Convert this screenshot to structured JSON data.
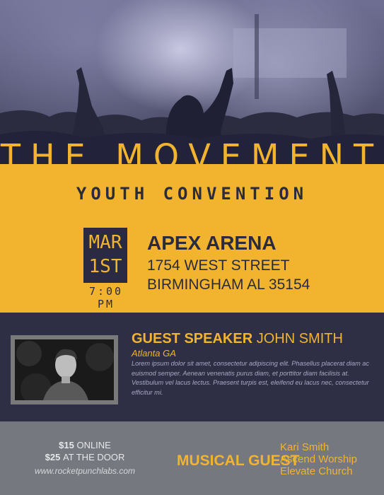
{
  "event": {
    "title": "THE MOVEMENT",
    "subtitle": "YOUTH CONVENTION"
  },
  "date": {
    "month": "MAR",
    "day": "1ST",
    "time": "7:00 PM"
  },
  "venue": {
    "name": "APEX ARENA",
    "street": "1754 WEST STREET",
    "city": "BIRMINGHAM AL 35154"
  },
  "speaker": {
    "label": "GUEST SPEAKER",
    "name": "JOHN SMITH",
    "location": "Atlanta GA",
    "bio": "Lorem ipsum dolor sit amet, consectetur adipiscing elit. Phasellus placerat diam ac euismod semper. Aenean venenatis purus diam, et porttitor diam facilisis at. Vestibulum vel lacus lectus. Praesent turpis est, eleifend eu lacus nec, consectetur efficitur mi."
  },
  "pricing": {
    "online_price": "$15",
    "online_label": "ONLINE",
    "door_price": "$25",
    "door_label": "AT THE DOOR",
    "url": "www.rocketpunchlabs.com"
  },
  "musical_guest": {
    "label": "MUSICAL GUEST",
    "names": [
      "Kari Smith",
      "Ascend Worship",
      "Elevate Church"
    ]
  },
  "colors": {
    "accent": "#f2b42e",
    "navy": "#2e2f45",
    "footer": "#75787f"
  }
}
